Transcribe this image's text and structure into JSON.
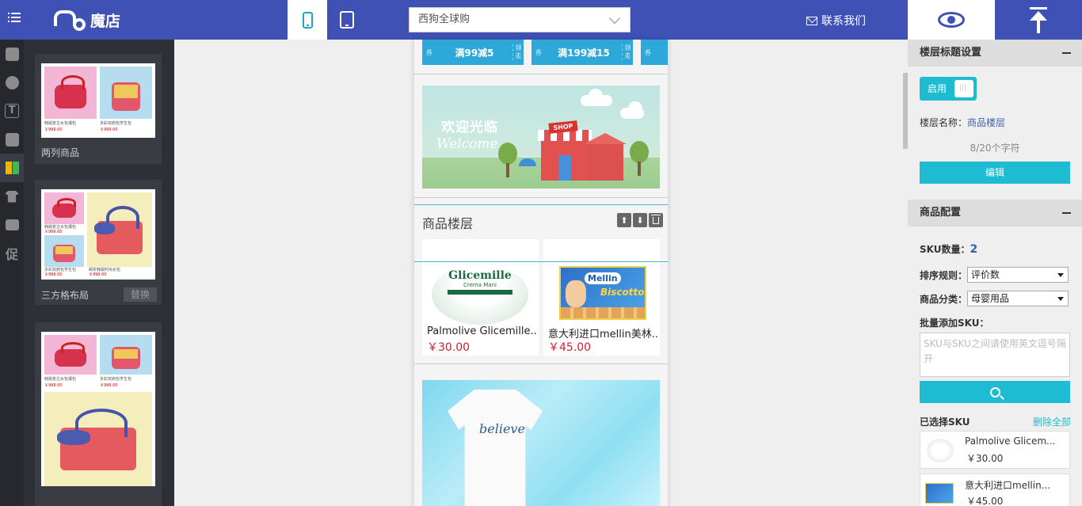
{
  "app": {
    "brand": "魔店"
  },
  "topbar": {
    "shop_select_value": "西狗全球购",
    "contact_label": "联系我们"
  },
  "templates": [
    {
      "label": "两列商品",
      "captions": [
        "韩版复古女包潮包",
        "多彩双肩包学生包"
      ],
      "prices": [
        "￥999.00",
        "￥999.00"
      ]
    },
    {
      "label": "三方格布局",
      "replace_label": "替换",
      "captions": [
        "韩版复古女包潮包",
        "多彩双肩包学生包",
        "邮折韩版时尚女包"
      ],
      "prices": [
        "￥999.00",
        "￥999.00",
        "￥999.00"
      ]
    },
    {
      "label": "",
      "captions": [
        "韩版复古女包潮包",
        "多彩双肩包学生包"
      ],
      "prices": [
        "￥999.00",
        "￥999.00"
      ]
    }
  ],
  "left_icons": [
    "puzzle-icon",
    "chat-icon",
    "text-icon",
    "puzzle-icon",
    "clothes-icon",
    "tshirt-icon",
    "image-icon",
    "promo-icon"
  ],
  "left_icon_text": {
    "text": "T",
    "promo": "促"
  },
  "phone": {
    "coupons": [
      {
        "tag": "券",
        "amount": "满99减5",
        "side": "领走"
      },
      {
        "tag": "券",
        "amount": "满199减15",
        "side": "领走"
      },
      {
        "tag": "券",
        "amount": "",
        "side": ""
      }
    ],
    "welcome": {
      "cn": "欢迎光临",
      "en": "Welcome",
      "shop_sign": "SHOP"
    },
    "floor": {
      "title": "商品楼层",
      "products": [
        {
          "name": "Palmolive Glicemille...",
          "price": "￥30.00",
          "img_brand": "Glicemille",
          "img_sub": "Crema Mani"
        },
        {
          "name": "意大利进口mellin美林...",
          "price": "￥45.00",
          "img_brand": "Mellin",
          "img_sub": "Biscotto"
        }
      ]
    },
    "shirt_text": "believe"
  },
  "right": {
    "floor_title_section": "楼层标题设置",
    "toggle_label": "启用",
    "floor_name_label": "楼层名称：",
    "floor_name_value": "商品楼层",
    "char_count": "8/20个字符",
    "edit_btn": "编辑",
    "product_config_section": "商品配置",
    "sku_count_label": "SKU数量：",
    "sku_count": "2",
    "sort_label": "排序规则：",
    "sort_value": "评价数",
    "category_label": "商品分类：",
    "category_value": "母婴用品",
    "batch_label": "批量添加SKU：",
    "batch_placeholder": "SKU与SKU之间请使用英文逗号隔开",
    "selected_label": "已选择SKU",
    "delete_all": "删除全部",
    "selected": [
      {
        "name": "Palmolive Glicem...",
        "price": "￥30.00"
      },
      {
        "name": "意大利进口mellin...",
        "price": "￥45.00"
      }
    ]
  },
  "colors": {
    "topbar": "#3f51b5",
    "accent": "#1ebcd3",
    "price": "#d2202e",
    "coupon": "#2ea8d8"
  }
}
